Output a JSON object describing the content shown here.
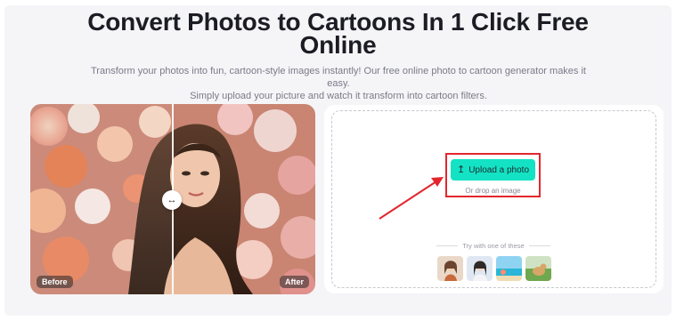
{
  "header": {
    "title_line1": "Convert Photos to Cartoons In 1 Click Free",
    "title_line2": "Online",
    "subtitle_line1": "Transform your photos into fun, cartoon-style images instantly! Our free online photo to cartoon generator makes it easy.",
    "subtitle_line2": "Simply upload your picture and watch it transform into cartoon filters."
  },
  "compare": {
    "before_label": "Before",
    "after_label": "After",
    "handle_icon": "left-right-arrows-icon"
  },
  "upload": {
    "button_label": "Upload a photo",
    "button_icon": "upload-arrow-icon",
    "drop_text": "Or drop an image",
    "try_label": "Try with one of these",
    "samples": [
      "woman-portrait",
      "girl-portrait",
      "beach-scene",
      "dog-on-grass"
    ]
  },
  "colors": {
    "accent": "#13e3c4",
    "highlight": "#e3262e",
    "title": "#1c1c24"
  }
}
